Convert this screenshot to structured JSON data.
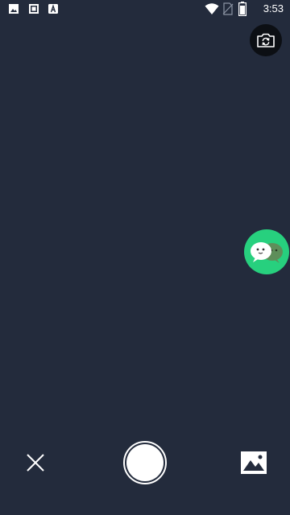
{
  "status_bar": {
    "time": "3:53",
    "left_icons": [
      "image-notification-icon",
      "square-notification-icon",
      "app-notification-icon"
    ],
    "right_icons": [
      "wifi-icon",
      "no-sim-icon",
      "battery-icon"
    ]
  },
  "controls": {
    "switch_camera_icon": "camera-switch-icon",
    "close_icon": "close-icon",
    "shutter_icon": "shutter-button",
    "gallery_icon": "gallery-icon"
  },
  "floating": {
    "chat_icon": "chat-bubbles-icon"
  },
  "colors": {
    "background": "#232b3c",
    "chat_green": "#27d07e",
    "white": "#ffffff"
  }
}
